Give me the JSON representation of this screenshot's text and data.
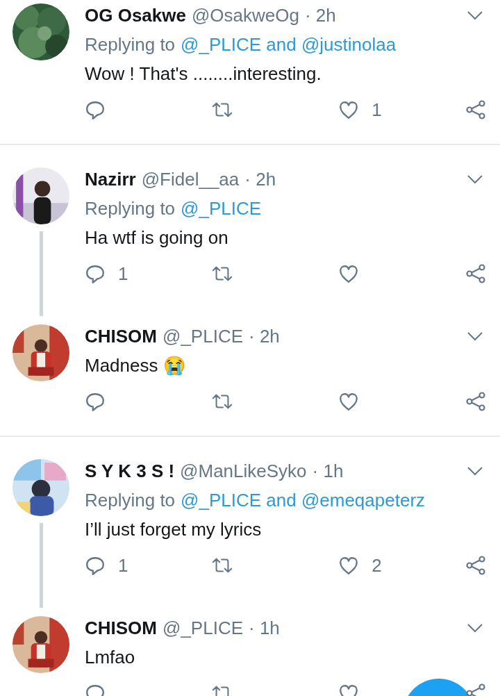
{
  "tweets": [
    {
      "name": "OG Osakwe",
      "handle": "@OsakweOg",
      "time": "· 2h",
      "replying_prefix": "Replying to",
      "reply_targets": "@_PLICE and @justinolaa",
      "text": "Wow ! That's ........interesting.",
      "like_count": "1",
      "thread_continues": false
    },
    {
      "name": "Nazirr",
      "handle": "@Fidel__aa",
      "time": "· 2h",
      "replying_prefix": "Replying to",
      "reply_targets": "@_PLICE",
      "text": "Ha wtf is going on",
      "reply_count": "1",
      "thread_continues": true
    },
    {
      "name": "CHISOM",
      "handle": "@_PLICE",
      "time": "· 2h",
      "text": "Madness 😭",
      "thread_continues": false
    },
    {
      "name": "S Y K 3 S !",
      "handle": "@ManLikeSyko",
      "time": "· 1h",
      "replying_prefix": "Replying to",
      "reply_targets": "@_PLICE and @emeqapeterz",
      "text": "I’ll just forget my lyrics",
      "reply_count": "1",
      "like_count": "2",
      "thread_continues": true
    },
    {
      "name": "CHISOM",
      "handle": "@_PLICE",
      "time": "· 1h",
      "text": "Lmfao",
      "thread_continues": false
    }
  ]
}
